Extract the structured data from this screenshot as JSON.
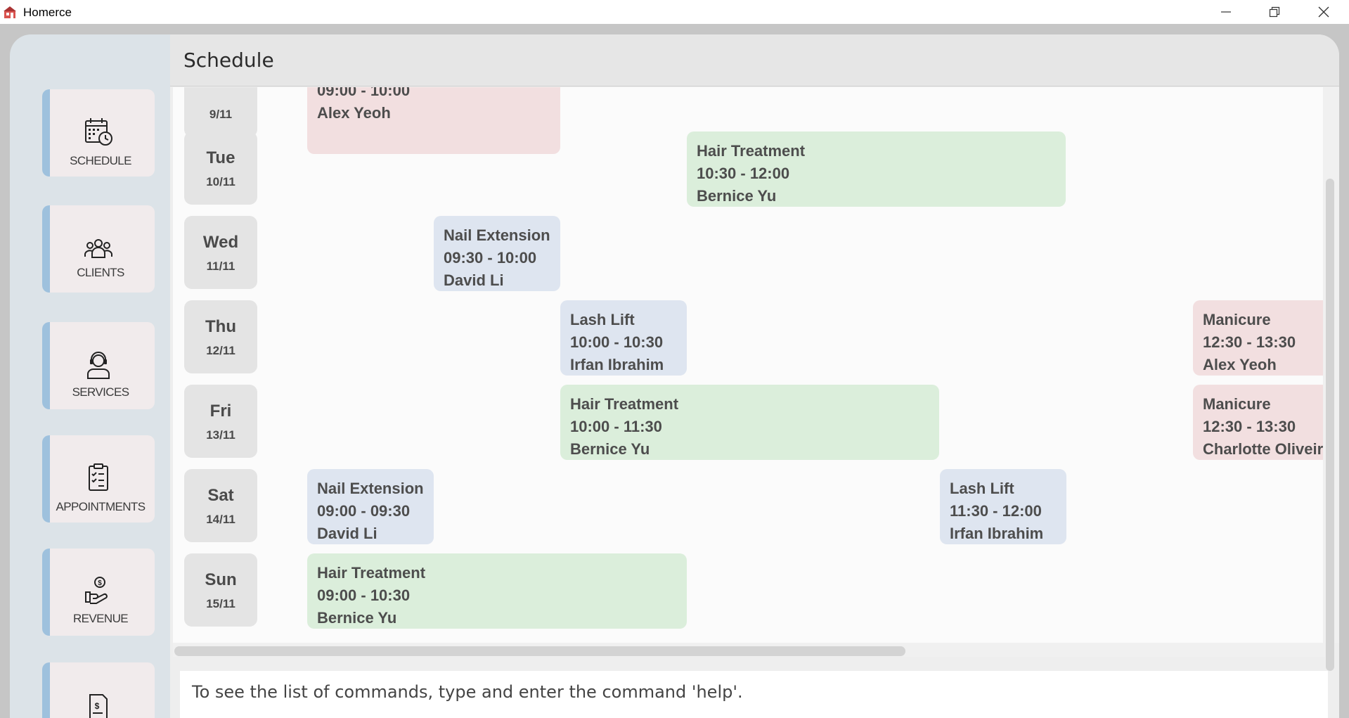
{
  "window": {
    "title": "Homerce"
  },
  "sidebar": {
    "items": [
      {
        "label": "SCHEDULE",
        "icon": "calendar-clock-icon"
      },
      {
        "label": "CLIENTS",
        "icon": "people-icon"
      },
      {
        "label": "SERVICES",
        "icon": "support-agent-icon"
      },
      {
        "label": "APPOINTMENTS",
        "icon": "clipboard-checklist-icon"
      },
      {
        "label": "REVENUE",
        "icon": "hand-coin-icon"
      },
      {
        "label": "",
        "icon": "invoice-icon"
      }
    ]
  },
  "header": {
    "title": "Schedule"
  },
  "schedule": {
    "days": [
      {
        "name": "",
        "date": "9/11"
      },
      {
        "name": "Tue",
        "date": "10/11"
      },
      {
        "name": "Wed",
        "date": "11/11"
      },
      {
        "name": "Thu",
        "date": "12/11"
      },
      {
        "name": "Fri",
        "date": "13/11"
      },
      {
        "name": "Sat",
        "date": "14/11"
      },
      {
        "name": "Sun",
        "date": "15/11"
      }
    ],
    "appointments": [
      {
        "service": "",
        "time": "09:00 - 10:00",
        "client": "Alex Yeoh",
        "color": "red"
      },
      {
        "service": "Hair Treatment",
        "time": "10:30 - 12:00",
        "client": "Bernice Yu",
        "color": "green"
      },
      {
        "service": "Nail Extension",
        "time": "09:30 - 10:00",
        "client": "David Li",
        "color": "blue"
      },
      {
        "service": "Lash Lift",
        "time": "10:00 - 10:30",
        "client": "Irfan Ibrahim",
        "color": "blue"
      },
      {
        "service": "Manicure",
        "time": "12:30 - 13:30",
        "client": "Alex Yeoh",
        "color": "red"
      },
      {
        "service": "Hair Treatment",
        "time": "10:00 - 11:30",
        "client": "Bernice Yu",
        "color": "green"
      },
      {
        "service": "Manicure",
        "time": "12:30 - 13:30",
        "client": "Charlotte Oliveiro",
        "color": "red"
      },
      {
        "service": "Nail Extension",
        "time": "09:00 - 09:30",
        "client": "David Li",
        "color": "blue"
      },
      {
        "service": "Lash Lift",
        "time": "11:30 - 12:00",
        "client": "Irfan Ibrahim",
        "color": "blue"
      },
      {
        "service": "Hair Treatment",
        "time": "09:00 - 10:30",
        "client": "Bernice Yu",
        "color": "green"
      }
    ]
  },
  "command": {
    "result_text": "To see the list of commands, type and enter the command 'help'."
  },
  "colors": {
    "green": "#dbeedb",
    "blue": "#dee5f0",
    "red": "#f2dfe0",
    "accent": "#9ec1dd"
  }
}
